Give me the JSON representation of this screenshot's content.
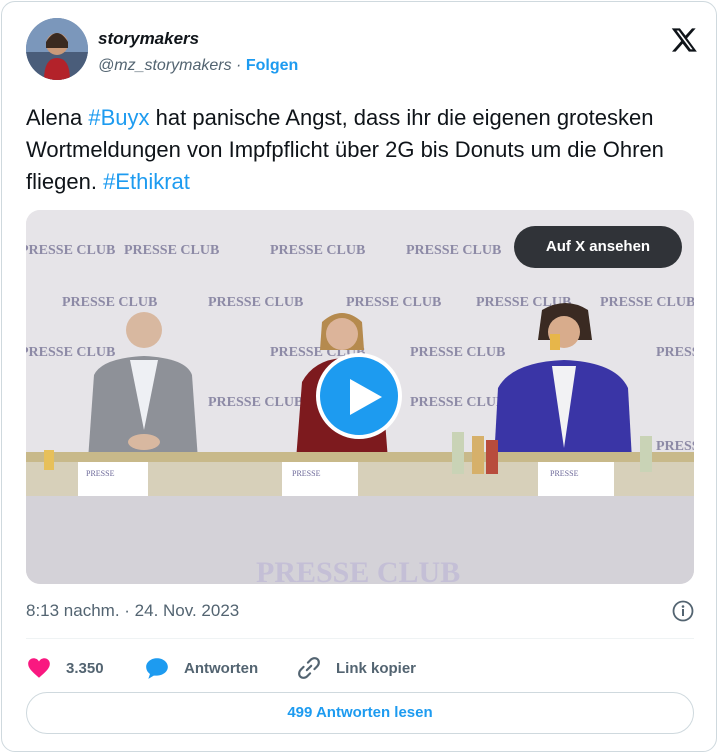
{
  "author": {
    "display_name": "storymakers",
    "handle": "@mz_storymakers",
    "separator": "·",
    "follow_label": "Folgen"
  },
  "tweet": {
    "segments": [
      {
        "text": "Alena ",
        "hashtag": false
      },
      {
        "text": "#Buyx",
        "hashtag": true
      },
      {
        "text": " hat panische Angst, dass ihr die eigenen grotesken Wortmeldungen von Impfpflicht über 2G bis Donuts um die Ohren fliegen. ",
        "hashtag": false
      },
      {
        "text": "#Ethikrat",
        "hashtag": true
      }
    ]
  },
  "media": {
    "watch_label": "Auf X ansehen",
    "backdrop_text": "PRESSE CLUB",
    "placard_labels": [
      "PRESSE",
      "PRESSE",
      "PRESSE"
    ],
    "banner_text": "PRESSE CLUB"
  },
  "meta": {
    "timestamp": "8:13 nachm. · 24. Nov. 2023"
  },
  "actions": {
    "likes": "3.350",
    "reply_label": "Antworten",
    "copy_label": "Link kopier"
  },
  "replies_button": "499 Antworten lesen",
  "icons": {
    "x_logo": "x-logo-icon",
    "info": "info-icon",
    "heart": "heart-icon",
    "reply": "reply-icon",
    "link": "link-icon",
    "play": "play-icon"
  },
  "colors": {
    "accent": "#1d9bf0",
    "like": "#f91880",
    "text": "#0f1419",
    "muted": "#536471",
    "border": "#cfd9de"
  }
}
